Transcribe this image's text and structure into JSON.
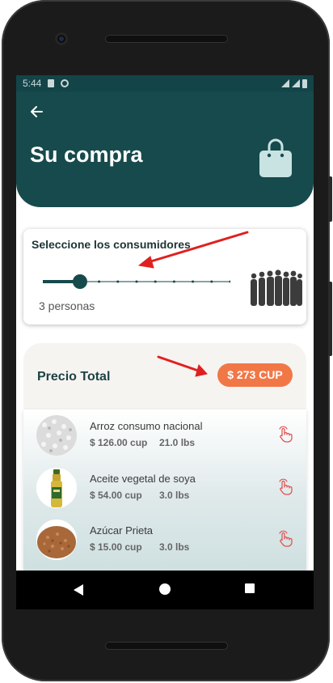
{
  "status_bar": {
    "time": "5:44"
  },
  "header": {
    "title": "Su compra"
  },
  "consumers": {
    "label": "Seleccione los consumidores",
    "count_text": "3 personas",
    "slider_value": 3,
    "slider_max": 10
  },
  "total": {
    "label": "Precio Total",
    "amount": "$ 273 CUP"
  },
  "products": [
    {
      "name": "Arroz consumo nacional",
      "price": "$ 126.00 cup",
      "weight": "21.0 lbs",
      "thumb": "rice"
    },
    {
      "name": "Aceite vegetal de soya",
      "price": "$ 54.00 cup",
      "weight": "3.0 lbs",
      "thumb": "oil-bottle"
    },
    {
      "name": "Azúcar Prieta",
      "price": "$ 15.00 cup",
      "weight": "3.0 lbs",
      "thumb": "brown-sugar"
    }
  ],
  "icons": {
    "back": "arrow-left-icon",
    "bag": "shopping-bag-icon",
    "tap": "hand-tap-icon",
    "crowd": "people-silhouettes-icon"
  },
  "colors": {
    "header": "#174a4c",
    "accent": "#f27747",
    "tap": "#e05555"
  }
}
